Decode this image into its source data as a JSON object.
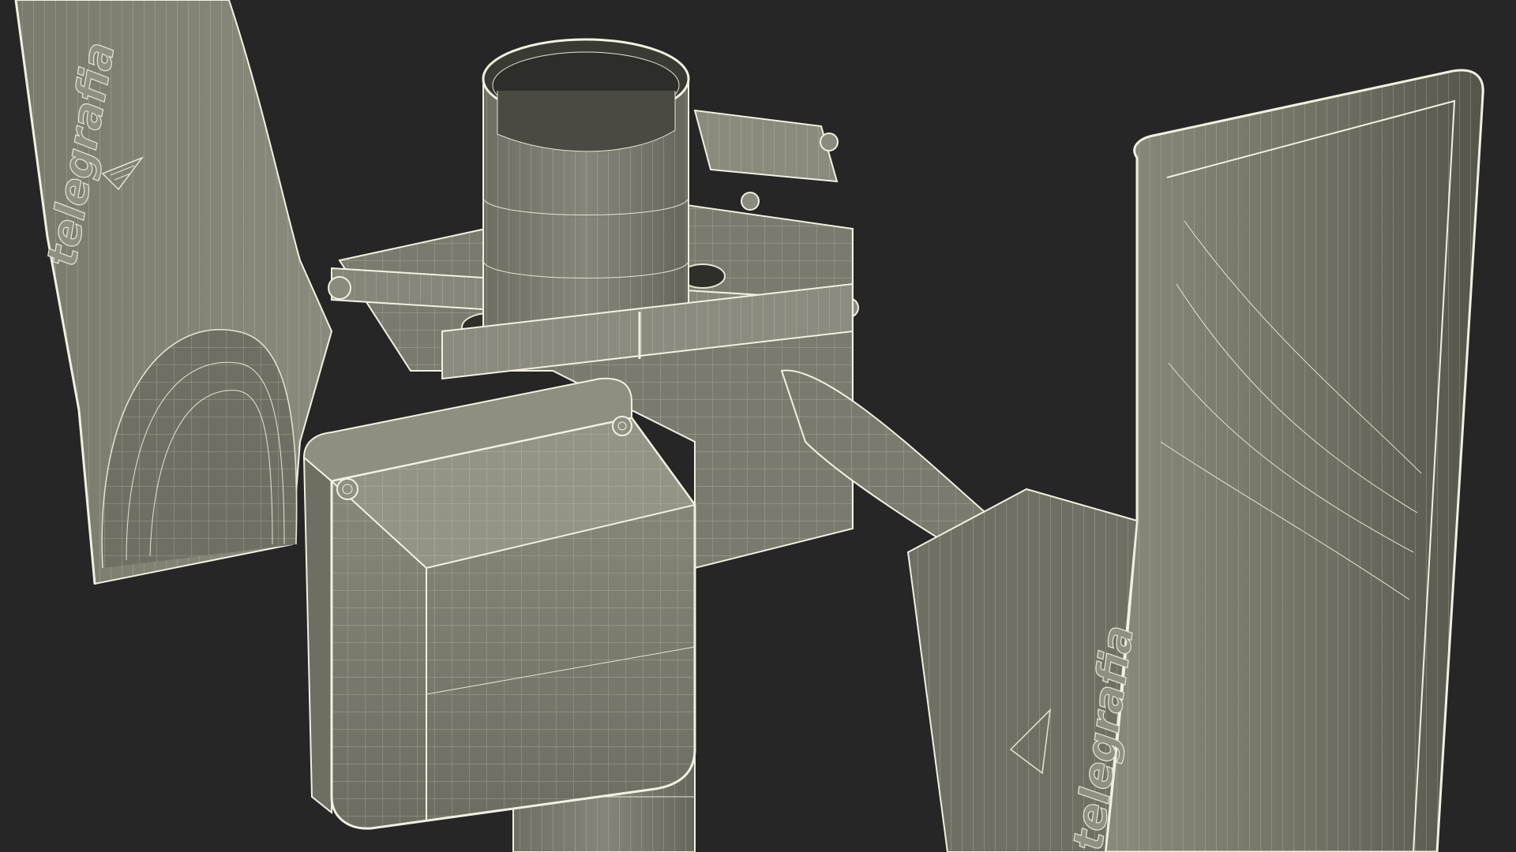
{
  "scene": {
    "background": "#262626",
    "model_fill": "#7d7d70",
    "model_fill_dark": "#5f5f55",
    "model_fill_light": "#8e8e80",
    "wire_color": "#e6e4d2",
    "edge_color": "#f2f0e0"
  },
  "labels": {
    "left_horn_logo": "telegrafia",
    "right_horn_logo": "telegrafia"
  },
  "icons": {
    "logo_mark": "arrow-triangle-icon"
  }
}
